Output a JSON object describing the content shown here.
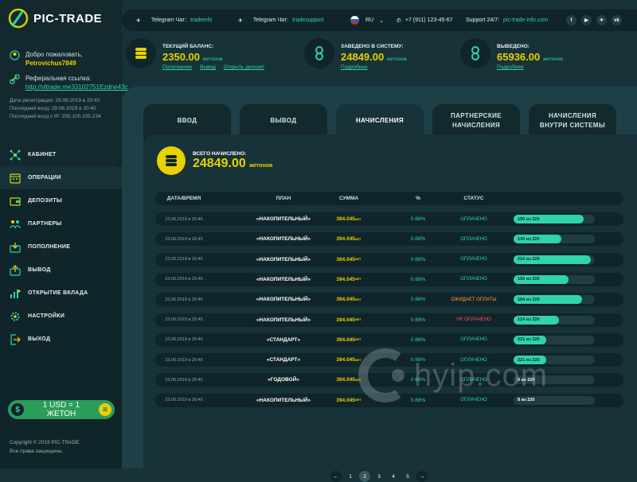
{
  "app": {
    "name": "PIC-TRADE"
  },
  "colors": {
    "accent": "#2fd3ad",
    "yellow": "#e8d200",
    "bg": "#173238",
    "dark": "#0f2529",
    "panel": "#1e3f45",
    "red": "#ff4b6a",
    "orange": "#f2a33a"
  },
  "user": {
    "welcome": "Добро пожаловать,",
    "name": "Petrovichus7849",
    "ref_label": "Реферальная ссылка:",
    "ref_link": "http://vltrade.me33102751Ezdne43c",
    "reg_date": "Дата регистрации: 29.06.2019 в 20:40",
    "last_login": "Последний вход: 29.06.2019 в 20:40",
    "last_ip": "Последний вход с IP: 200.100.105.234"
  },
  "nav": [
    {
      "label": "КАБИНЕТ",
      "icon": "network-icon"
    },
    {
      "label": "ОПЕРАЦИИ",
      "icon": "calendar-icon"
    },
    {
      "label": "ДЕПОЗИТЫ",
      "icon": "wallet-icon"
    },
    {
      "label": "ПАРТНЕРЫ",
      "icon": "partners-icon"
    },
    {
      "label": "ПОПОЛНЕНИЕ",
      "icon": "deposit-icon"
    },
    {
      "label": "ВЫВОД",
      "icon": "withdraw-icon"
    },
    {
      "label": "ОТКРЫТИЕ ВКЛАДА",
      "icon": "open-deposit-icon"
    },
    {
      "label": "НАСТРОЙКИ",
      "icon": "settings-icon"
    },
    {
      "label": "ВЫХОД",
      "icon": "logout-icon"
    }
  ],
  "rate": {
    "text": "1 USD = 1 ЖЕТОН"
  },
  "footer": {
    "line1": "Copyright © 2019 PIC-TRADE.",
    "line2": "Все права защищены."
  },
  "topbar": {
    "tg1_label": "Telegram Чат:",
    "tg1_value": "tradeinfo",
    "tg2_label": "Telegram Чат:",
    "tg2_value": "tradesupport",
    "lang": "RU",
    "phone": "+7 (911) 123-45-67",
    "support_label": "Support 24/7:",
    "support_value": "pic-trade-info.com",
    "social": [
      "f",
      "▶",
      "✈",
      "vk"
    ]
  },
  "stats": {
    "balance": {
      "label": "ТЕКУЩИЙ БАЛАНС:",
      "value": "2350.00",
      "unit": "жетонов",
      "links": [
        "Пополнение",
        "Вывод",
        "Открыть депозит"
      ]
    },
    "deposited": {
      "label": "ЗАВЕДЕНО В СИСТЕМУ:",
      "value": "24849.00",
      "unit": "жетонов",
      "link": "Подробнее"
    },
    "withdrawn": {
      "label": "ВЫВЕДЕНО:",
      "value": "65936.00",
      "unit": "жетонов",
      "link": "Подробнее"
    }
  },
  "tabs": [
    {
      "label": "ВВОД"
    },
    {
      "label": "ВЫВОД"
    },
    {
      "label": "НАЧИСЛЕНИЯ"
    },
    {
      "label": "ПАРТНЕРСКИЕ НАЧИСЛЕНИЯ"
    },
    {
      "label": "НАЧИСЛЕНИЯ ВНУТРИ СИСТЕМЫ"
    }
  ],
  "total": {
    "label": "ВСЕГО НАЧИСЛЕНО:",
    "value": "24849.00",
    "unit": "жетонов"
  },
  "table": {
    "headers": [
      "ДАТА/ВРЕМЯ",
      "ПЛАН",
      "СУММА",
      "%",
      "СТАТУС"
    ],
    "rows": [
      {
        "date": "23.06.2019 в 20:45",
        "plan": "«НАКОПИТЕЛЬНЫЙ»",
        "sum": "394.045",
        "cur": "ЖЕТ",
        "pct": "0.68%",
        "status": "ОПЛАЧЕНО",
        "status_color": "#2fd3ad",
        "progress": "190 из 220",
        "fill": 0.86
      },
      {
        "date": "23.06.2019 в 20:45",
        "plan": "«НАКОПИТЕЛЬНЫЙ»",
        "sum": "394.045",
        "cur": "ЖЕТ",
        "pct": "0.68%",
        "status": "ОПЛАЧЕНО",
        "status_color": "#2fd3ad",
        "progress": "130 из 220",
        "fill": 0.59
      },
      {
        "date": "23.06.2019 в 20:45",
        "plan": "«НАКОПИТЕЛЬНЫЙ»",
        "sum": "394.045",
        "cur": "ЖЕТ",
        "pct": "0.68%",
        "status": "ОПЛАЧЕНО",
        "status_color": "#2fd3ad",
        "progress": "210 из 220",
        "fill": 0.95
      },
      {
        "date": "23.06.2019 в 20:45",
        "plan": "«НАКОПИТЕЛЬНЫЙ»",
        "sum": "394.045",
        "cur": "ЖЕТ",
        "pct": "0.68%",
        "status": "ОПЛАЧЕНО",
        "status_color": "#2fd3ad",
        "progress": "150 из 220",
        "fill": 0.68
      },
      {
        "date": "23.06.2019 в 20:45",
        "plan": "«НАКОПИТЕЛЬНЫЙ»",
        "sum": "394.045",
        "cur": "ЖЕТ",
        "pct": "0.68%",
        "status": "ОЖИДАЕТ ОПЛАТЫ",
        "status_color": "#f2a33a",
        "progress": "184 из 220",
        "fill": 0.84
      },
      {
        "date": "23.06.2019 в 20:45",
        "plan": "«НАКОПИТЕЛЬНЫЙ»",
        "sum": "394.045",
        "cur": "ЖЕТ",
        "pct": "0.68%",
        "status": "НЕ ОПЛАЧЕНО",
        "status_color": "#ff4b6a",
        "progress": "124 из 220",
        "fill": 0.56
      },
      {
        "date": "23.06.2019 в 20:45",
        "plan": "«СТАНДАРТ»",
        "sum": "394.045",
        "cur": "ЖЕТ",
        "pct": "0.68%",
        "status": "ОПЛАЧЕНО",
        "status_color": "#2fd3ad",
        "progress": "221 из 220",
        "fill": 0.4
      },
      {
        "date": "23.06.2019 в 20:45",
        "plan": "«СТАНДАРТ»",
        "sum": "394.045",
        "cur": "ЖЕТ",
        "pct": "0.68%",
        "status": "ОПЛАЧЕНО",
        "status_color": "#2fd3ad",
        "progress": "221 из 220",
        "fill": 0.4
      },
      {
        "date": "23.06.2019 в 20:45",
        "plan": "«ГОДОВОЙ»",
        "sum": "394.045",
        "cur": "ЖЕТ",
        "pct": "0.68%",
        "status": "ОПЛАЧЕНО",
        "status_color": "#2fd3ad",
        "progress": "0 из 220",
        "fill": 0
      },
      {
        "date": "23.06.2019 в 20:45",
        "plan": "«НАКОПИТЕЛЬНЫЙ»",
        "sum": "394.045",
        "cur": "ЖЕТ",
        "pct": "0.68%",
        "status": "ОПЛАЧЕНО",
        "status_color": "#2fd3ad",
        "progress": "8 из 220",
        "fill": 0.04
      }
    ]
  },
  "pagination": {
    "prev": "←",
    "pages": [
      "1",
      "2",
      "3",
      "4",
      "5"
    ],
    "current": "2",
    "next": "→"
  },
  "watermark": {
    "text": "hyip.com"
  }
}
